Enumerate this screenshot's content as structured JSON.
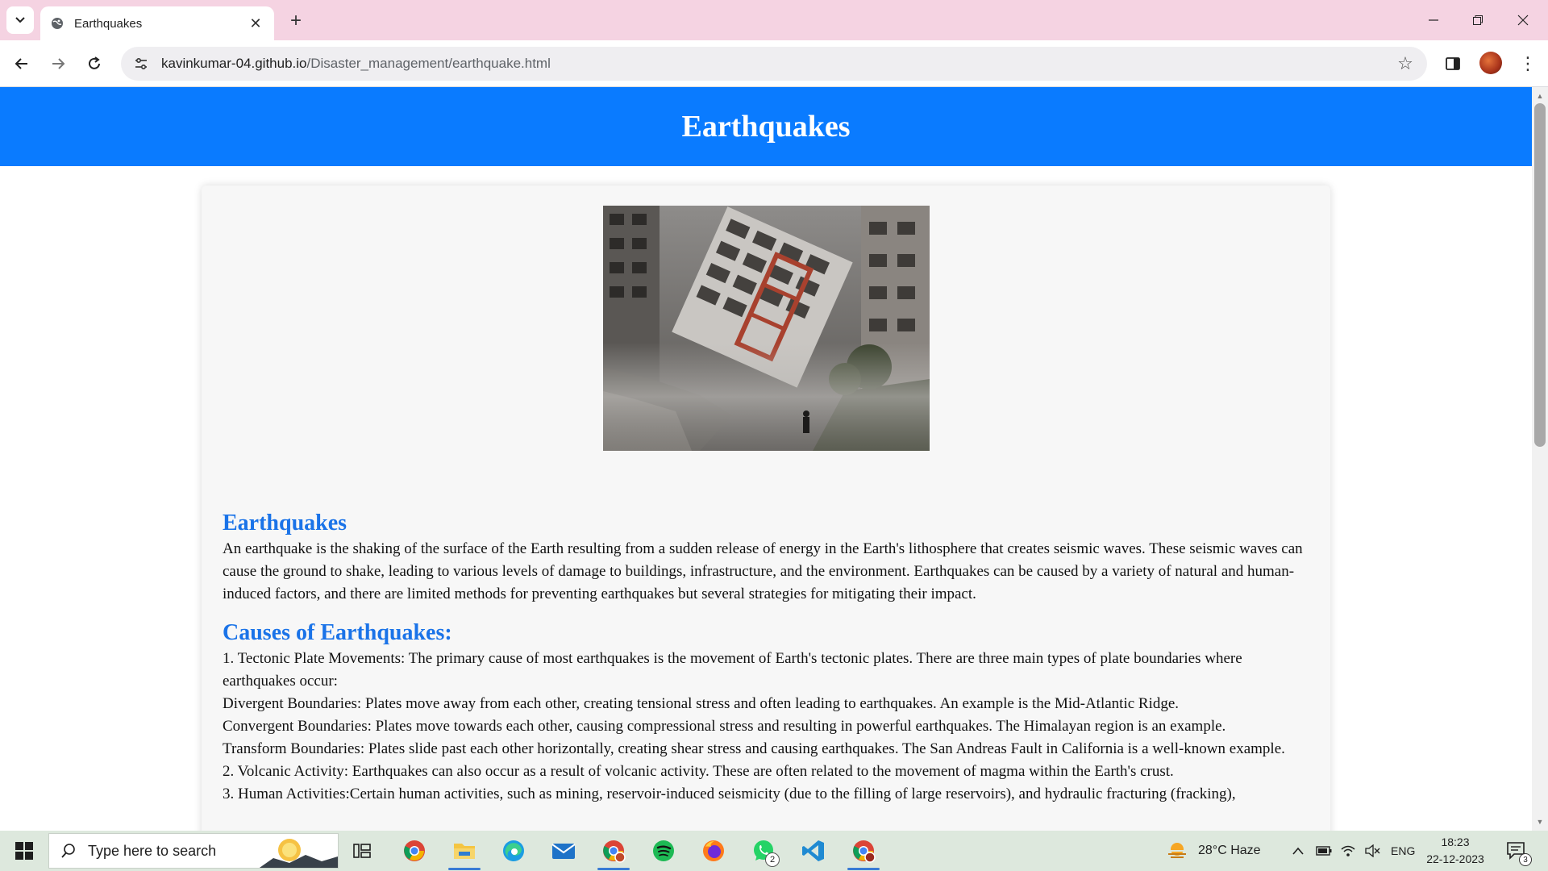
{
  "browser": {
    "tab_title": "Earthquakes",
    "close_glyph": "✕",
    "new_tab_glyph": "+",
    "url_host": "kavinkumar-04.github.io",
    "url_path": "/Disaster_management/earthquake.html",
    "menu_glyph": "⋮",
    "star_glyph": "☆"
  },
  "page": {
    "header_title": "Earthquakes",
    "intro_heading": "Earthquakes",
    "intro_text": "An earthquake is the shaking of the surface of the Earth resulting from a sudden release of energy in the Earth's lithosphere that creates seismic waves. These seismic waves can cause the ground to shake, leading to various levels of damage to buildings, infrastructure, and the environment. Earthquakes can be caused by a variety of natural and human-induced factors, and there are limited methods for preventing earthquakes but several strategies for mitigating their impact.",
    "causes_heading": "Causes of Earthquakes:",
    "causes": [
      "1. Tectonic Plate Movements: The primary cause of most earthquakes is the movement of Earth's tectonic plates. There are three main types of plate boundaries where earthquakes occur:",
      "Divergent Boundaries: Plates move away from each other, creating tensional stress and often leading to earthquakes. An example is the Mid-Atlantic Ridge.",
      "Convergent Boundaries: Plates move towards each other, causing compressional stress and resulting in powerful earthquakes. The Himalayan region is an example.",
      "Transform Boundaries: Plates slide past each other horizontally, creating shear stress and causing earthquakes. The San Andreas Fault in California is a well-known example.",
      "2. Volcanic Activity: Earthquakes can also occur as a result of volcanic activity. These are often related to the movement of magma within the Earth's crust.",
      "3. Human Activities:Certain human activities, such as mining, reservoir-induced seismicity (due to the filling of large reservoirs), and hydraulic fracturing (fracking),"
    ]
  },
  "taskbar": {
    "search_placeholder": "Type here to search",
    "whatsapp_badge": "2",
    "weather": "28°C  Haze",
    "language": "ENG",
    "time": "18:23",
    "date": "22-12-2023",
    "notification_badge": "3"
  },
  "colors": {
    "header_blue": "#0a7bff",
    "heading_blue": "#1a73e8",
    "tabstrip_pink": "#f5d3e2",
    "taskbar": "#dde8dd"
  }
}
